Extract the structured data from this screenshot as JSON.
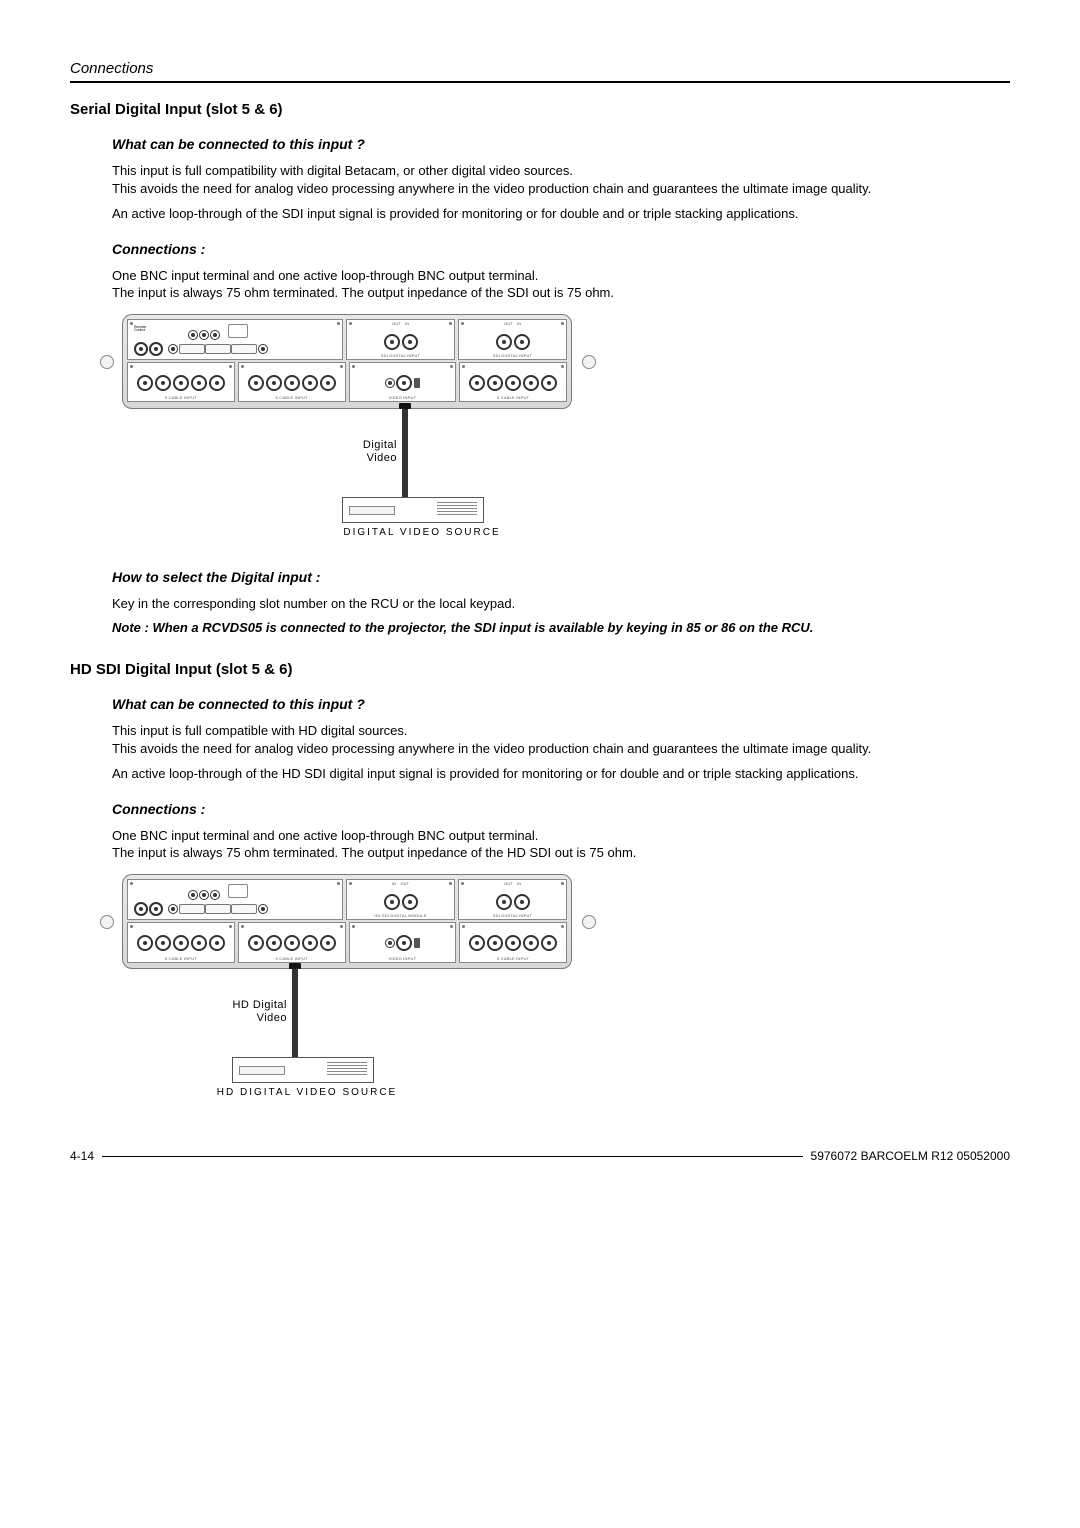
{
  "header": {
    "title": "Connections"
  },
  "section1": {
    "title": "Serial Digital Input (slot 5 & 6)",
    "sub1": "What can be connected to this input ?",
    "p1": "This input is full compatibility with digital Betacam, or other digital video sources.",
    "p2": "This avoids the need for analog video processing anywhere in the video production chain and guarantees the ultimate image quality.",
    "p3": "An active loop-through of the SDI input signal is provided for monitoring or for double and or triple stacking applications.",
    "sub2": "Connections :",
    "p4": "One BNC input terminal and one active loop-through BNC output terminal.",
    "p5": "The input is always 75 ohm terminated.  The output inpedance of the SDI out is 75 ohm.",
    "diagLabel": "Digital Video",
    "diagCaption": "DIGITAL VIDEO SOURCE",
    "sub3": "How to select the Digital input :",
    "p6": "Key in the corresponding slot number on the RCU or the local keypad.",
    "note": "Note : When a RCVDS05 is connected to the projector, the SDI input is available by keying in 85 or 86 on the RCU."
  },
  "section2": {
    "title": "HD SDI Digital Input (slot 5 & 6)",
    "sub1": "What can be connected to this input ?",
    "p1": "This input is full compatible with HD digital sources.",
    "p2": "This avoids the need for analog video processing anywhere in the video production chain and guarantees the ultimate image quality.",
    "p3": "An active loop-through of the HD SDI digital input signal is provided for monitoring or for double and or triple stacking applications.",
    "sub2": "Connections :",
    "p4": "One BNC input terminal and one active loop-through BNC output terminal.",
    "p5": "The input is always 75 ohm terminated.  The output inpedance of the HD SDI out is 75 ohm.",
    "diagLabel": "HD Digital Video",
    "diagCaption": "HD DIGITAL VIDEO SOURCE"
  },
  "footer": {
    "left": "4-14",
    "right": "5976072 BARCOELM R12 05052000"
  },
  "panelLabels": {
    "sdi": "SDI DIGITAL INPUT",
    "hdsdi": "HD SDI DIGITAL MODULE",
    "video": "VIDEO INPUT",
    "out": "OUT",
    "in": "IN"
  }
}
